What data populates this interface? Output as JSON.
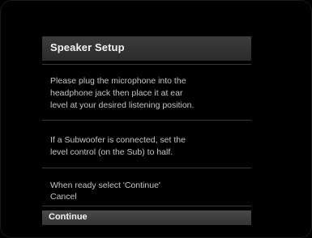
{
  "dialog": {
    "title": "Speaker Setup",
    "paragraph1": "Please plug the microphone into the\nheadphone jack then place it at ear\nlevel at your desired listening position.",
    "paragraph2": "If a Subwoofer is connected, set the\nlevel control (on the Sub) to half.",
    "prompt": "When ready select 'Continue'",
    "options": [
      {
        "label": "Cancel",
        "selected": false
      },
      {
        "label": "Continue",
        "selected": true
      }
    ]
  },
  "colors": {
    "background": "#000000",
    "title_bar": "#333333",
    "text": "#c4c4c4",
    "highlight": "#3f3f3f"
  }
}
